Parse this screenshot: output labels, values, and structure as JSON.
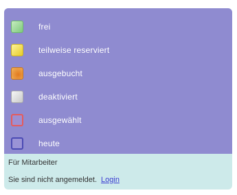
{
  "legend": {
    "items": [
      {
        "label": "frei",
        "icon": "green-square-icon"
      },
      {
        "label": "teilweise reserviert",
        "icon": "yellow-square-icon"
      },
      {
        "label": "ausgebucht",
        "icon": "orange-square-icon"
      },
      {
        "label": "deaktiviert",
        "icon": "gray-square-icon"
      },
      {
        "label": "ausgewählt",
        "icon": "red-outline-square-icon"
      },
      {
        "label": "heute",
        "icon": "blue-outline-square-icon"
      }
    ]
  },
  "footer": {
    "title": "Für Mitarbeiter",
    "message": "Sie sind nicht angemeldet.",
    "login_label": "Login"
  },
  "colors": {
    "legend_bg": "#8f8bd0",
    "footer_bg": "#cdeaea",
    "link": "#3b3bd1"
  }
}
